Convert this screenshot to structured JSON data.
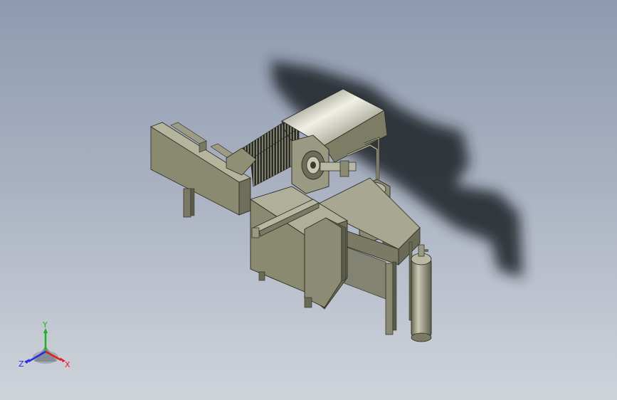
{
  "viewport": {
    "background_top": "#8e9ab0",
    "background_bottom": "#cfd3da",
    "model_color": "#8a8a70",
    "shadow_color": "#1e2026"
  },
  "triad": {
    "icon": "coordinate-triad-icon",
    "x_label": "X",
    "y_label": "Y",
    "z_label": "Z",
    "x_color": "#e02020",
    "y_color": "#20b020",
    "z_color": "#2030e0"
  }
}
